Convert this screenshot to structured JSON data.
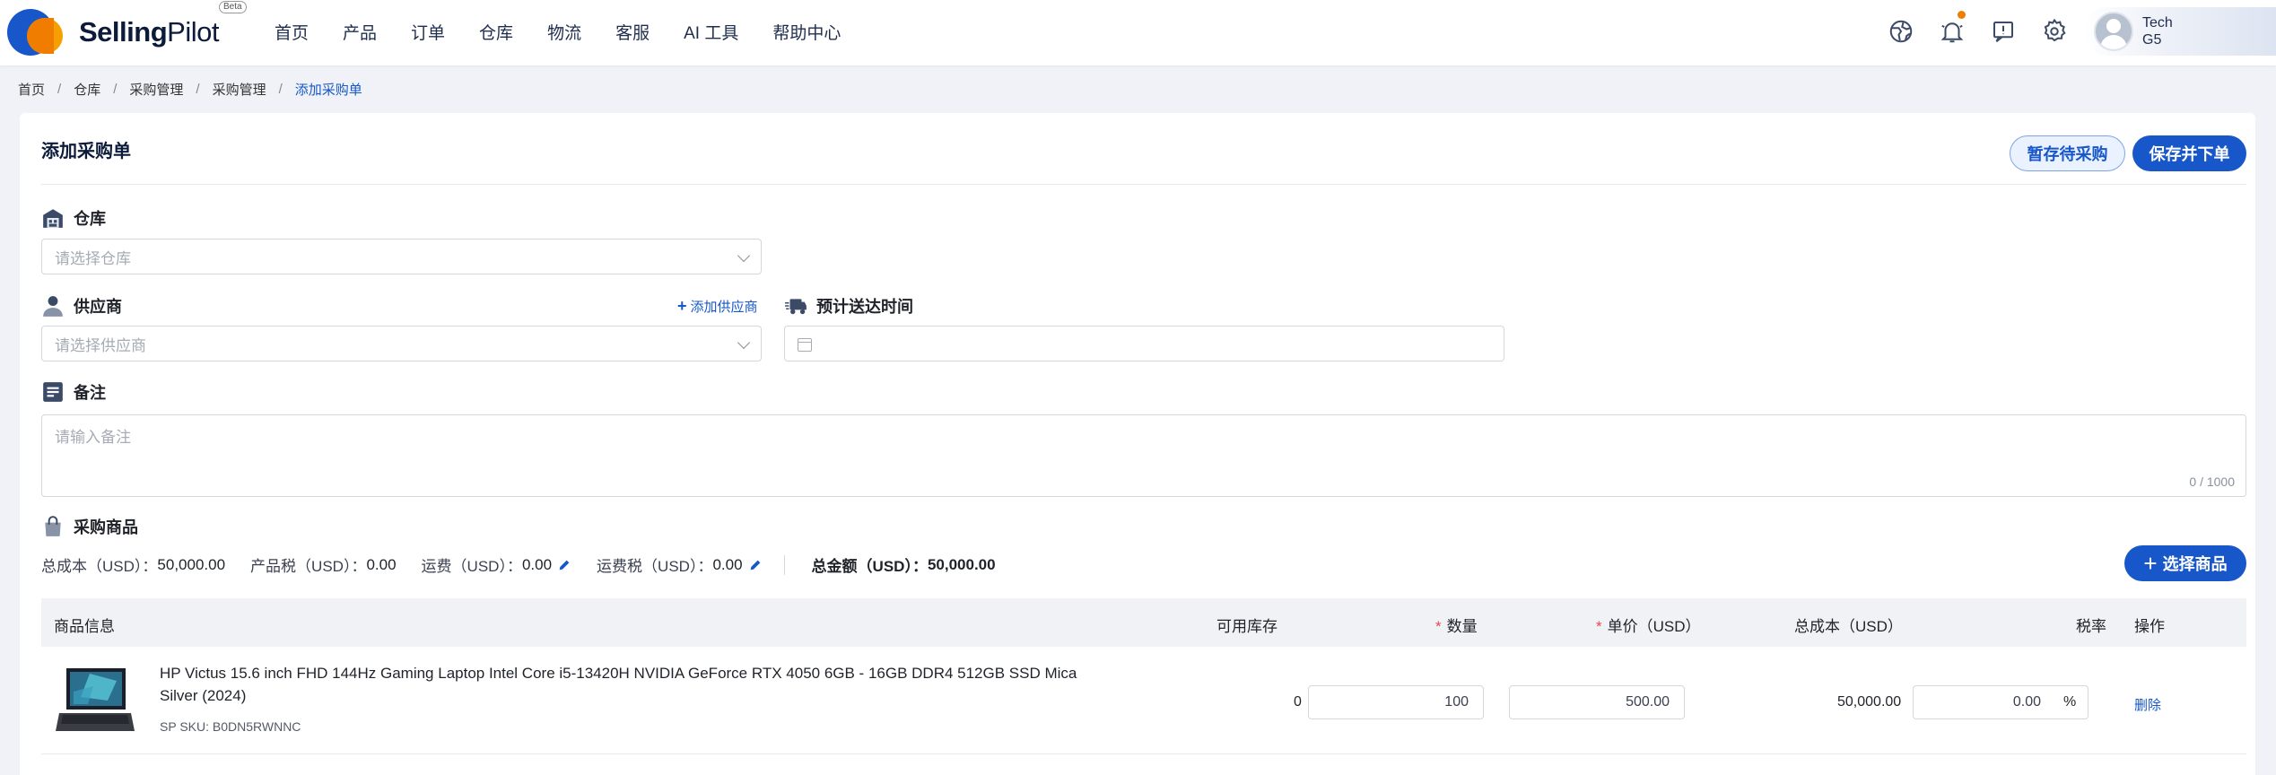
{
  "brand": {
    "name_bold": "Selling",
    "name_rest": "Pilot",
    "badge": "Beta"
  },
  "nav": [
    "首页",
    "产品",
    "订单",
    "仓库",
    "物流",
    "客服",
    "AI 工具",
    "帮助中心"
  ],
  "user": {
    "line1": "Tech",
    "line2": "G5"
  },
  "breadcrumb": [
    "首页",
    "仓库",
    "采购管理",
    "采购管理",
    "添加采购单"
  ],
  "page": {
    "title": "添加采购单",
    "save_draft": "暂存待采购",
    "save_order": "保存并下单"
  },
  "form": {
    "warehouse": {
      "label": "仓库",
      "placeholder": "请选择仓库"
    },
    "supplier": {
      "label": "供应商",
      "placeholder": "请选择供应商",
      "add_link": "添加供应商"
    },
    "eta": {
      "label": "预计送达时间"
    },
    "remark": {
      "label": "备注",
      "placeholder": "请输入备注",
      "counter": "0 / 1000"
    }
  },
  "products": {
    "label": "采购商品",
    "select_button": "选择商品",
    "summary": {
      "cost_label": "总成本（USD）：",
      "cost_value": "50,000.00",
      "tax_label": "产品税（USD）：",
      "tax_value": "0.00",
      "shipping_label": "运费（USD）：",
      "shipping_value": "0.00",
      "shipping_tax_label": "运费税（USD）：",
      "shipping_tax_value": "0.00",
      "total_label": "总金额（USD）：",
      "total_value": "50,000.00"
    },
    "columns": {
      "info": "商品信息",
      "stock": "可用库存",
      "qty": "数量",
      "price": "单价（USD）",
      "total": "总成本（USD）",
      "tax": "税率",
      "action": "操作"
    },
    "rows": [
      {
        "name": "HP Victus 15.6 inch FHD 144Hz Gaming Laptop Intel Core i5-13420H NVIDIA GeForce RTX 4050 6GB - 16GB DDR4 512GB SSD Mica Silver (2024)",
        "sku": "SP SKU: B0DN5RWNNC",
        "stock": "0",
        "qty": "100",
        "price": "500.00",
        "total": "50,000.00",
        "tax": "0.00",
        "tax_unit": "%",
        "action": "删除"
      }
    ]
  },
  "colors": {
    "primary": "#1757c9",
    "accent": "#f07d00",
    "required": "#e5484d"
  }
}
